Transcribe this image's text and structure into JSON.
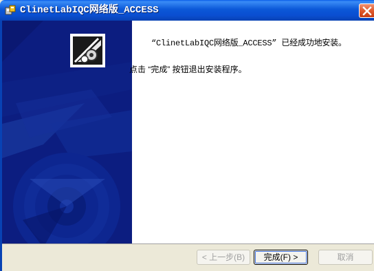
{
  "window": {
    "title": "ClinetLabIQC网络版_ACCESS",
    "close_icon": "close-icon",
    "title_icon": "installer-icon"
  },
  "content": {
    "message_line1": "“ClinetLabIQC网络版_ACCESS” 已经成功地安装。",
    "message_line2": "点击 “完成” 按钮退出安装程序。"
  },
  "buttons": {
    "back_label": "< 上一步(B)",
    "finish_label": "完成(F) >",
    "cancel_label": "取消"
  },
  "colors": {
    "titlebar": "#0a58d8",
    "side_panel": "#0c1d80",
    "button_face": "#ece9d8",
    "close_button": "#e05a2c"
  }
}
